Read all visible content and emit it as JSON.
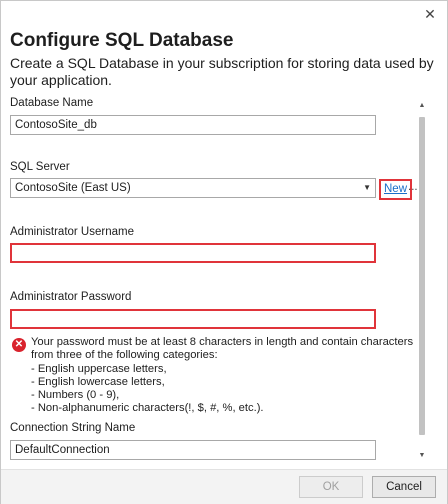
{
  "dialog": {
    "close_glyph": "✕",
    "title": "Configure SQL Database",
    "description": "Create a SQL Database in your subscription for storing data used by your application."
  },
  "fields": {
    "database_name": {
      "label": "Database Name",
      "value": "ContosoSite_db"
    },
    "sql_server": {
      "label": "SQL Server",
      "selected": "ContosoSite (East US)",
      "new_link": "New",
      "more": "..."
    },
    "admin_username": {
      "label": "Administrator Username",
      "value": ""
    },
    "admin_password": {
      "label": "Administrator Password",
      "value": ""
    },
    "connection_string": {
      "label": "Connection String Name",
      "value": "DefaultConnection"
    }
  },
  "error": {
    "icon": "error-x-icon",
    "lines": [
      "Your password must be at least 8 characters in length and contain characters",
      "from three of the following categories:",
      "- English uppercase letters,",
      "- English lowercase letters,",
      "- Numbers (0 - 9),",
      "- Non-alphanumeric characters(!, $, #, %, etc.)."
    ]
  },
  "footer": {
    "ok_label": "OK",
    "cancel_label": "Cancel"
  },
  "colors": {
    "error_red": "#e0343a",
    "link_blue": "#1a6fc9"
  }
}
